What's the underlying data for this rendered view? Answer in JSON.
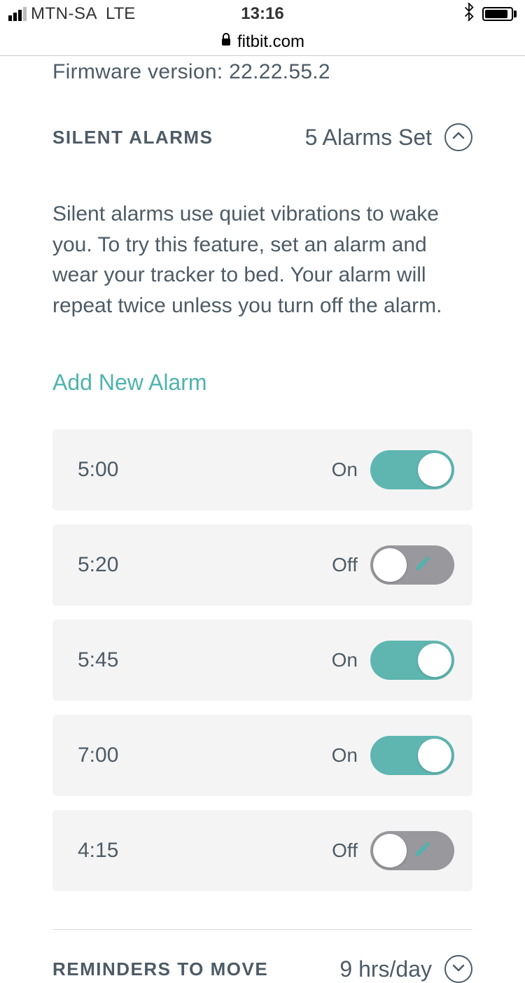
{
  "status_bar": {
    "carrier": "MTN-SA",
    "network": "LTE",
    "time": "13:16"
  },
  "url_bar": {
    "domain": "fitbit.com"
  },
  "firmware": {
    "label": "Firmware version:",
    "value": "22.22.55.2"
  },
  "silent_alarms": {
    "title": "SILENT ALARMS",
    "count_label": "5 Alarms Set",
    "description": "Silent alarms use quiet vibrations to wake you. To try this feature, set an alarm and wear your tracker to bed. Your alarm will repeat twice unless you turn off the alarm.",
    "add_label": "Add New Alarm",
    "alarms": [
      {
        "time": "5:00",
        "state": "On",
        "on": true
      },
      {
        "time": "5:20",
        "state": "Off",
        "on": false
      },
      {
        "time": "5:45",
        "state": "On",
        "on": true
      },
      {
        "time": "7:00",
        "state": "On",
        "on": true
      },
      {
        "time": "4:15",
        "state": "Off",
        "on": false
      }
    ]
  },
  "reminders": {
    "title": "REMINDERS TO MOVE",
    "value": "9 hrs/day"
  }
}
